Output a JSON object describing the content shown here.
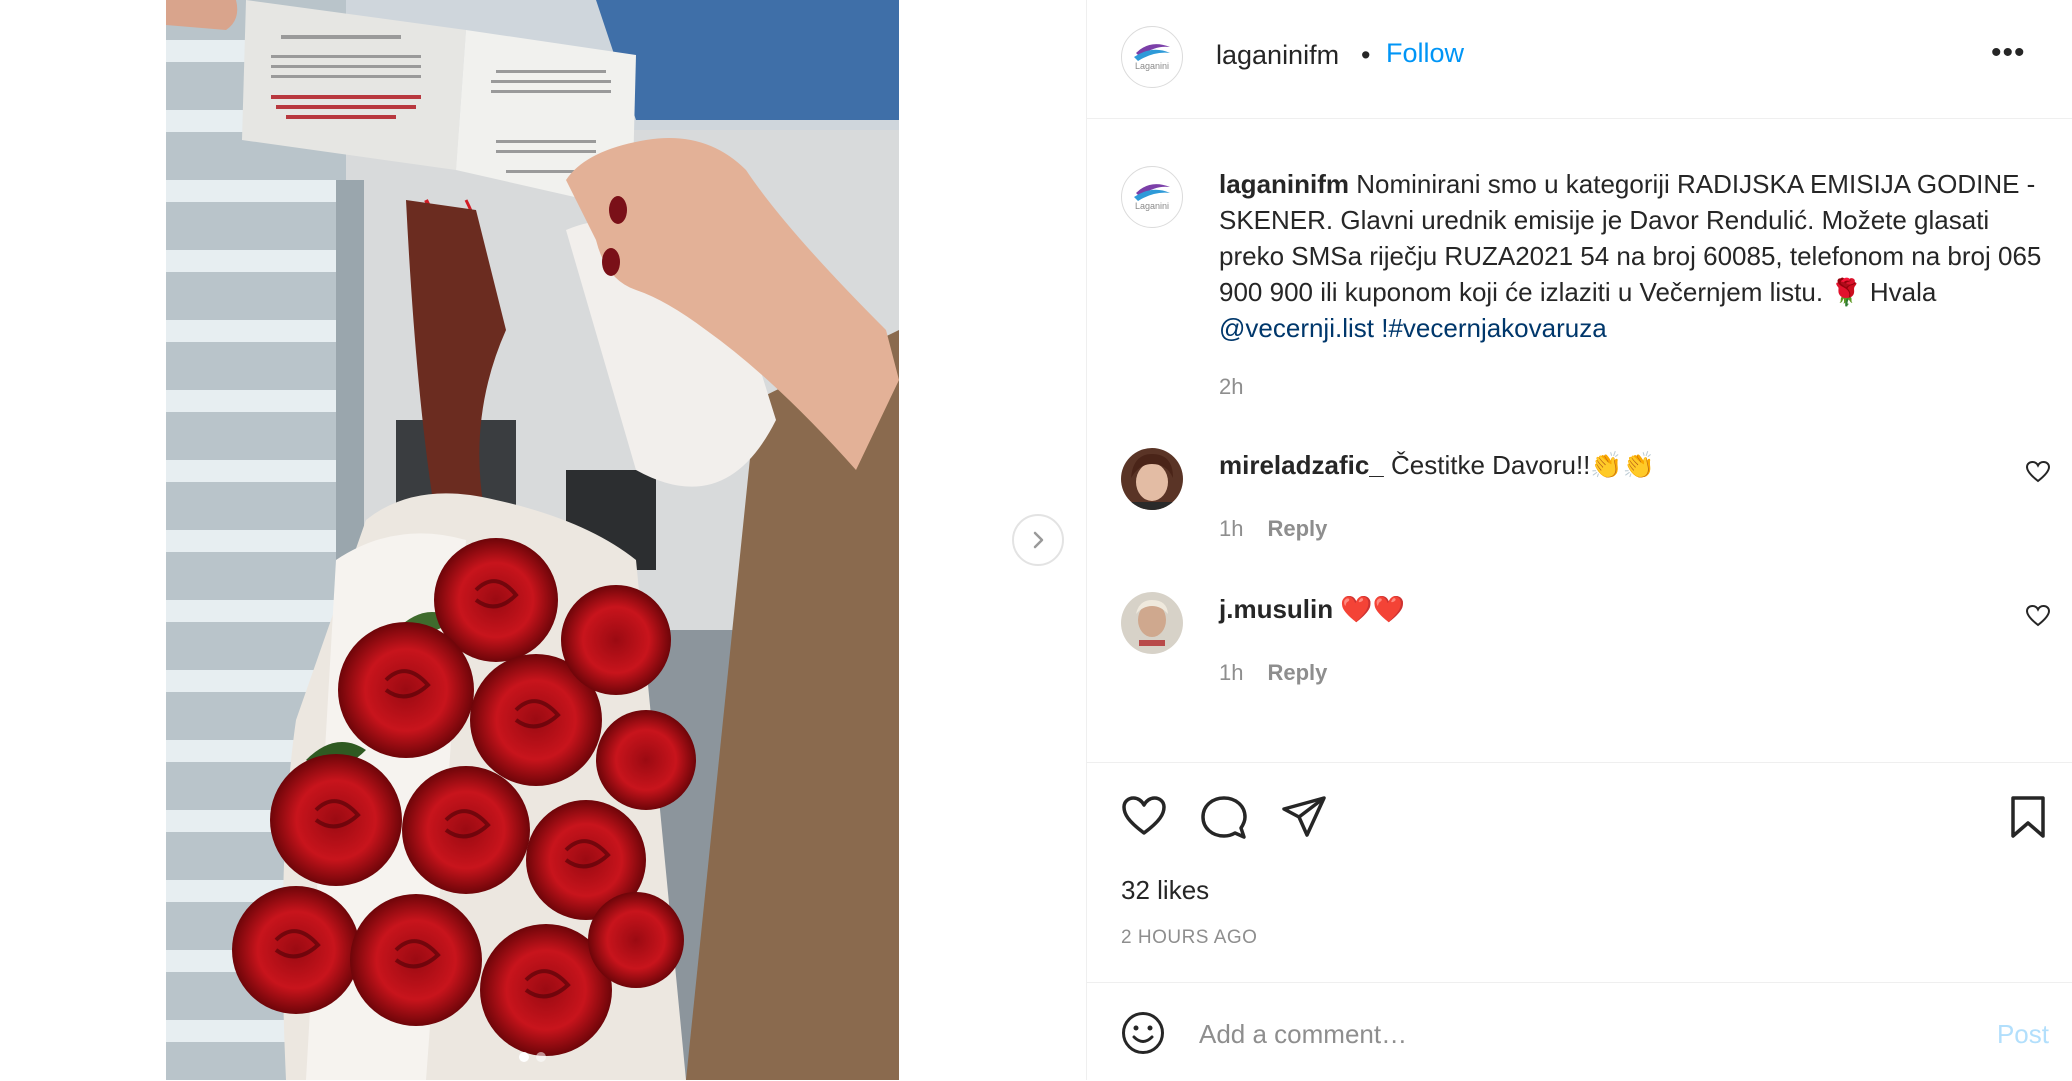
{
  "post": {
    "account": "laganinifm",
    "avatar_logo": "Laganini",
    "follow_label": "Follow",
    "separator": "•",
    "more_label": "•••",
    "caption_user": "laganinifm",
    "caption_text": "Nominirani smo u kategoriji RADIJSKA EMISIJA GODINE - SKENER. Glavni urednik emisije je Davor Rendulić. Možete glasati preko SMSa riječju RUZA2021 54 na broj 60085, telefonom na broj 065 900 900 ili kuponom koji će izlaziti u Večernjem listu. 🌹 Hvala ",
    "caption_mention": "@vecernji.list",
    "caption_space": " ",
    "caption_hashtag": "!#vecernjakovaruza",
    "caption_time": "2h",
    "likes": "32 likes",
    "time_ago": "2 HOURS AGO",
    "media_dots": 2,
    "media_active_dot": 1
  },
  "comments": [
    {
      "user": "mireladzafic_",
      "text": "Čestitke Davoru!!👏👏",
      "time": "1h",
      "reply_label": "Reply"
    },
    {
      "user": "j.musulin",
      "text": "❤️❤️",
      "time": "1h",
      "reply_label": "Reply"
    }
  ],
  "add_comment": {
    "placeholder": "Add a comment…",
    "post_label": "Post"
  },
  "icons": {
    "next": "chevron-right-icon",
    "like": "heart-icon",
    "comment": "comment-icon",
    "share": "paper-plane-icon",
    "save": "bookmark-icon",
    "emoji": "smiley-icon"
  },
  "colors": {
    "accent": "#0095f6",
    "text": "#262626",
    "muted": "#8e8e8e",
    "link": "#00376b",
    "post_disabled": "#b2dffc"
  }
}
